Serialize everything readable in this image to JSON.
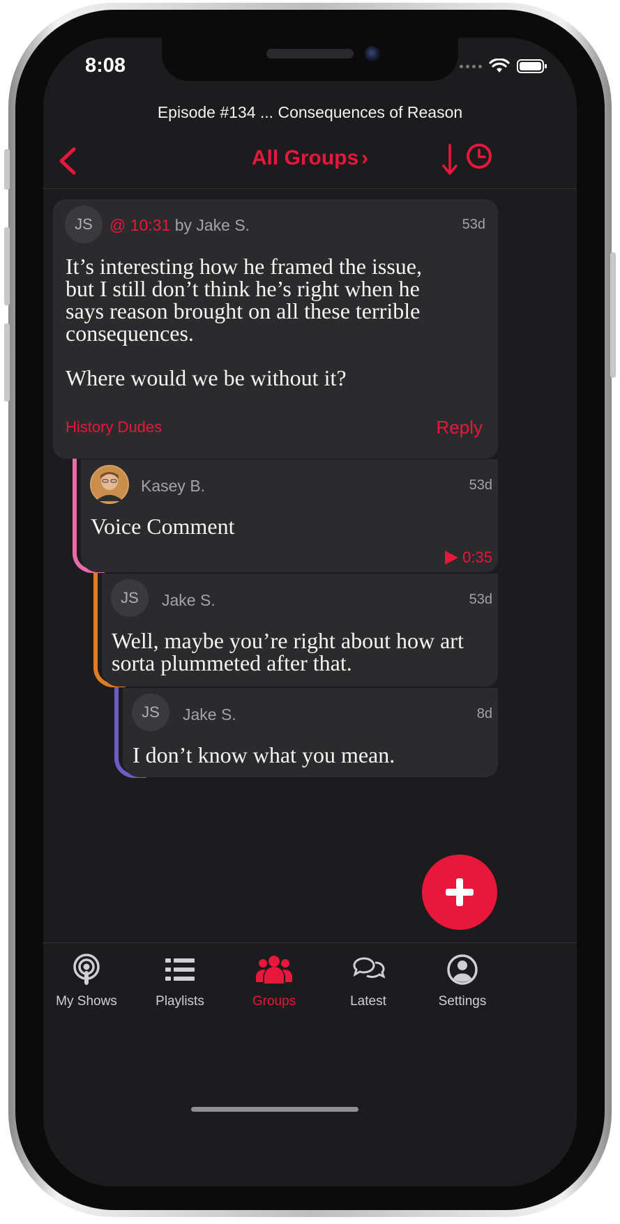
{
  "status_bar": {
    "time": "8:08"
  },
  "header": {
    "episode_title": "Episode #134 ... Consequences of Reason",
    "nav_title": "All Groups",
    "chevron": "›"
  },
  "comments": [
    {
      "avatar_initials": "JS",
      "timestamp": "@ 10:31",
      "by": "by Jake S.",
      "age": "53d",
      "paragraph1_lines": [
        "It’s interesting how he framed the issue,",
        "but I still don’t think he’s right when he",
        "says reason brought on all these terrible",
        "consequences."
      ],
      "paragraph2": "Where would we be without it?",
      "group": "History Dudes",
      "reply": "Reply"
    },
    {
      "author": "Kasey B.",
      "age": "53d",
      "text": "Voice Comment",
      "duration": "0:35",
      "accent": "#e86aa8"
    },
    {
      "avatar_initials": "JS",
      "author": "Jake S.",
      "age": "53d",
      "text_lines": [
        "Well, maybe you’re right about how art",
        "sorta plummeted after that."
      ],
      "accent": "#e07b20"
    },
    {
      "avatar_initials": "JS",
      "author": "Jake S.",
      "age": "8d",
      "text": "I don’t know what you mean.",
      "accent": "#6f5bc8"
    }
  ],
  "tabs": [
    {
      "label": "My Shows",
      "icon": "podcast-icon"
    },
    {
      "label": "Playlists",
      "icon": "list-icon"
    },
    {
      "label": "Groups",
      "icon": "groups-icon",
      "active": true
    },
    {
      "label": "Latest",
      "icon": "chat-bubbles-icon"
    },
    {
      "label": "Settings",
      "icon": "user-circle-icon"
    }
  ],
  "colors": {
    "accent": "#e8173b",
    "background": "#1c1c1e",
    "card": "#2b2b2d"
  }
}
